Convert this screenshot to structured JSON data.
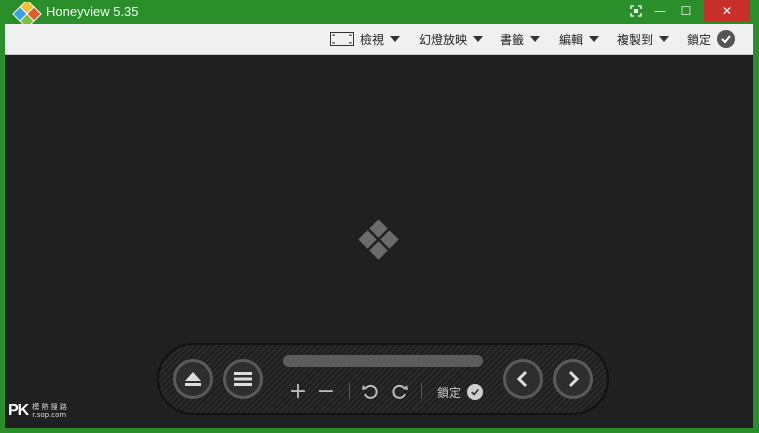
{
  "window": {
    "title": "Honeyview 5.35",
    "controls": {
      "restore_icon": "fullscreen-icon",
      "minimize": "—",
      "maximize": "☐",
      "close": "✕"
    }
  },
  "toolbar": {
    "items": [
      {
        "label": "檢視",
        "has_dropdown": true,
        "icon": "frame-icon"
      },
      {
        "label": "幻燈放映",
        "has_dropdown": true
      },
      {
        "label": "書籤",
        "has_dropdown": true
      },
      {
        "label": "編輯",
        "has_dropdown": true
      },
      {
        "label": "複製到",
        "has_dropdown": true
      },
      {
        "label": "鎖定",
        "has_dropdown": false,
        "icon": "check-circle-icon"
      }
    ]
  },
  "controlbar": {
    "lock_label": "鎖定",
    "zoom_in": "+",
    "zoom_out": "−"
  },
  "watermark": {
    "brand": "PK",
    "line1": "模 熱 搜 路",
    "line2": "r.sop.com"
  },
  "colors": {
    "frame": "#2a8f2a",
    "close_button": "#c9302c",
    "viewer_bg": "#202020",
    "toolbar_bg": "#f0f0f0"
  }
}
